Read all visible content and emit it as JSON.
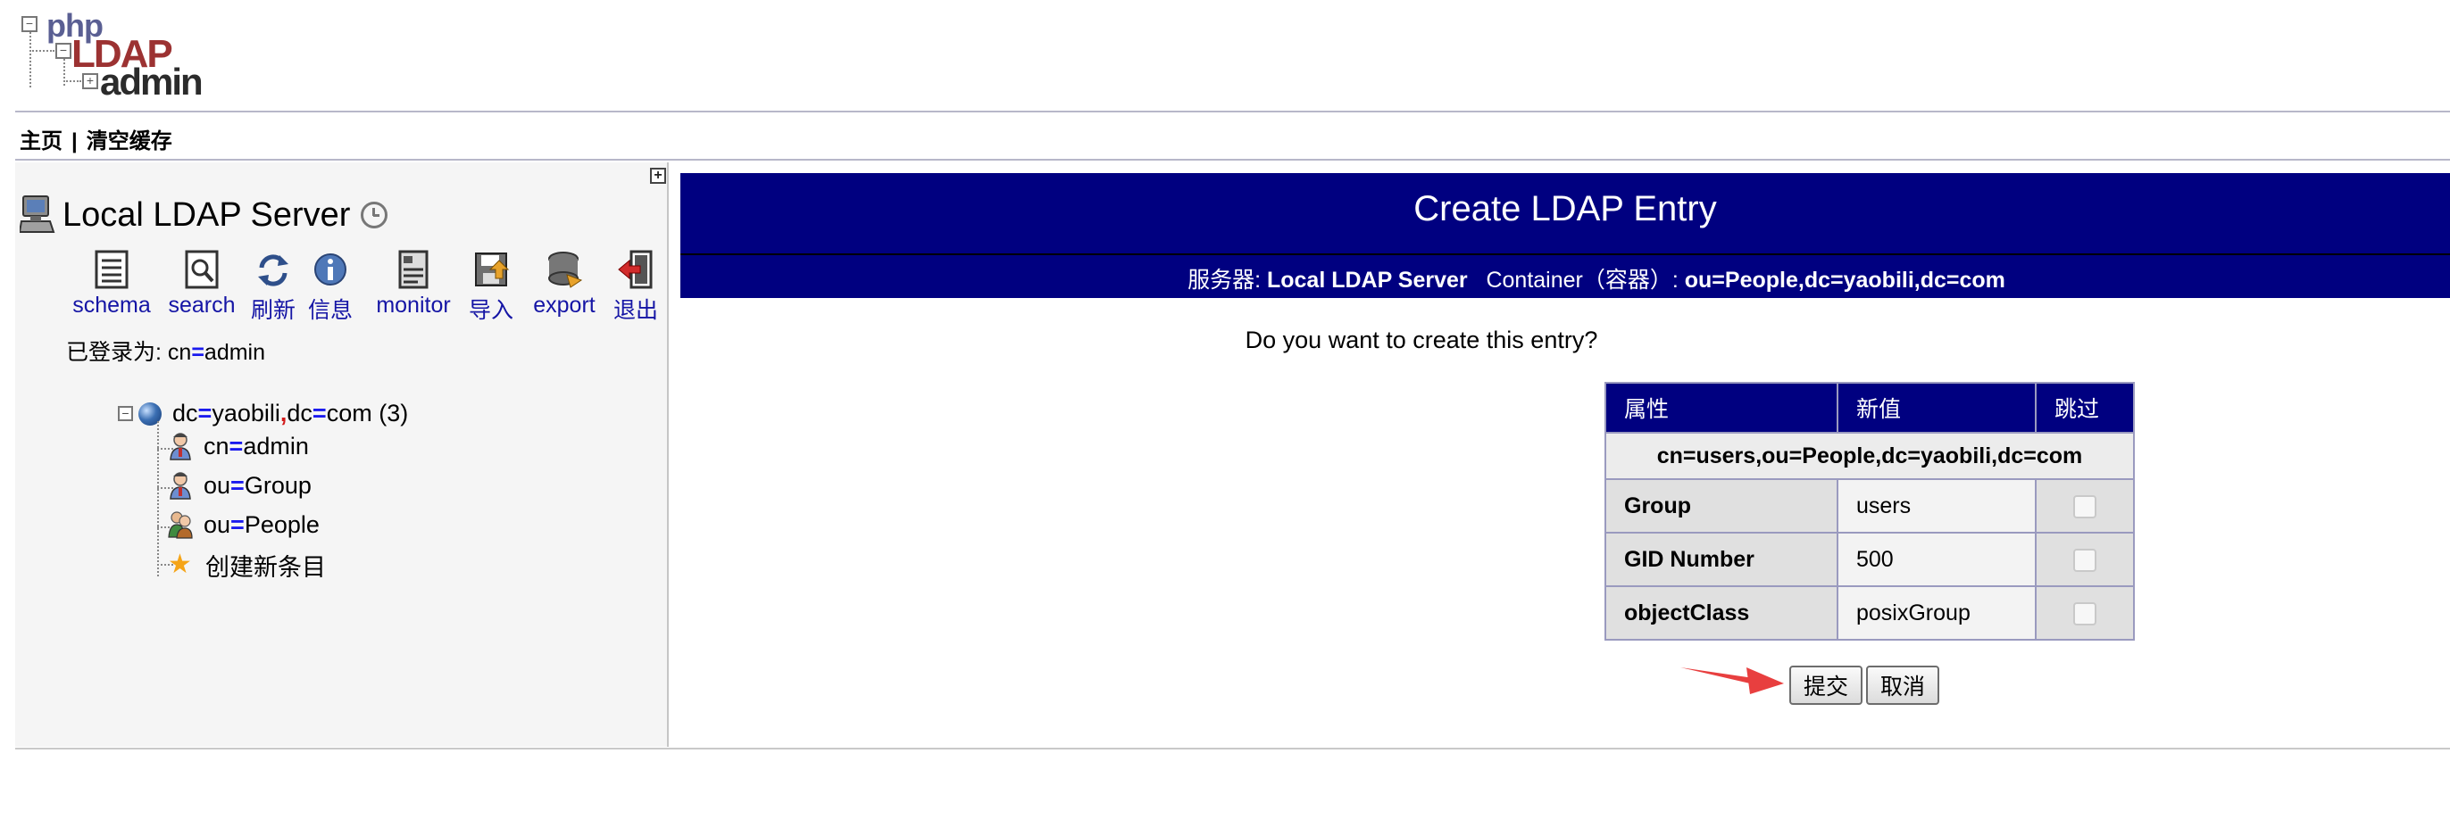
{
  "logo": {
    "line1": "php",
    "line2": "LDAP",
    "line3": "admin"
  },
  "top_menu": {
    "home": "主页",
    "separator": "|",
    "purge_cache": "清空缓存"
  },
  "left": {
    "server_name": "Local LDAP Server",
    "toolbar": [
      {
        "label": "schema",
        "icon": "schema-icon"
      },
      {
        "label": "search",
        "icon": "search-icon"
      },
      {
        "label": "刷新",
        "icon": "refresh-icon"
      },
      {
        "label": "信息",
        "icon": "info-icon"
      },
      {
        "label": "monitor",
        "icon": "monitor-icon"
      },
      {
        "label": "导入",
        "icon": "import-icon"
      },
      {
        "label": "export",
        "icon": "export-icon"
      },
      {
        "label": "退出",
        "icon": "logout-icon"
      }
    ],
    "logged_in_prefix": "已登录为: ",
    "logged_in_attr": "cn",
    "logged_in_value": "admin",
    "tree": {
      "root": {
        "a1": "dc",
        "v1": "yaobili",
        "a2": "dc",
        "v2": "com",
        "count": "(3)"
      },
      "children": [
        {
          "attr": "cn",
          "value": "admin",
          "icon": "user-icon"
        },
        {
          "attr": "ou",
          "value": "Group",
          "icon": "user-icon"
        },
        {
          "attr": "ou",
          "value": "People",
          "icon": "people-icon"
        }
      ],
      "create": "创建新条目"
    }
  },
  "main": {
    "title": "Create LDAP Entry",
    "server_label": "服务器: ",
    "server_value": "Local LDAP Server",
    "container_label": "Container（容器）: ",
    "container_value": "ou=People,dc=yaobili,dc=com",
    "question": "Do you want to create this entry?",
    "table": {
      "headers": [
        "属性",
        "新值",
        "跳过"
      ],
      "dn": "cn=users,ou=People,dc=yaobili,dc=com",
      "rows": [
        {
          "attr": "Group",
          "value": "users"
        },
        {
          "attr": "GID Number",
          "value": "500"
        },
        {
          "attr": "objectClass",
          "value": "posixGroup"
        }
      ]
    },
    "submit": "提交",
    "cancel": "取消"
  },
  "colors": {
    "header_bg": "#000080",
    "arrow": "#e83f3f",
    "link": "#1515a5"
  }
}
